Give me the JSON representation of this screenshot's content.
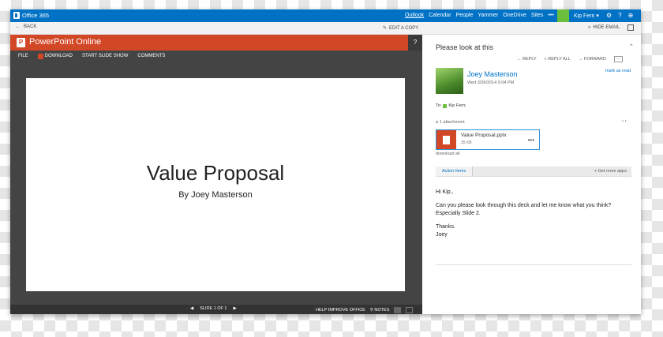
{
  "topbar": {
    "brand": "Office 365",
    "nav": [
      "Outlook",
      "Calendar",
      "People",
      "Yammer",
      "OneDrive",
      "Sites"
    ],
    "more": "•••",
    "user": "Kip Fern ▾",
    "gear": "⚙",
    "help": "?",
    "globe": "⊕"
  },
  "subbar": {
    "back": "BACK",
    "edit_copy": "EDIT A COPY",
    "hide_email": "HIDE EMAIL"
  },
  "ppt": {
    "logo": "P",
    "title": "PowerPoint Online",
    "help": "?",
    "menu": [
      "FILE",
      "DOWNLOAD",
      "START SLIDE SHOW",
      "COMMENTS"
    ],
    "slide_title": "Value Proposal",
    "slide_subtitle": "By Joey Masterson",
    "slide_counter": "SLIDE 1 OF 1",
    "help_improve": "HELP IMPROVE OFFICE",
    "notes": "NOTES"
  },
  "mail": {
    "subject": "Please look at this",
    "reply": "REPLY",
    "reply_all": "REPLY ALL",
    "forward": "FORWARD",
    "sender": "Joey Masterson",
    "date": "Wed 3/26/2014 9:04 PM",
    "mark_read": "mark as read",
    "to_label": "To:",
    "to_name": "Kip Fern;",
    "attachment_count": "1 attachment",
    "attachment_name": "Value Proposal.pptx",
    "attachment_size": "35 KB",
    "download_all": "download all",
    "action_items": "Action Items",
    "get_more_apps": "Get more apps",
    "body": [
      "Hi Kip.,",
      "Can you please look through this deck and let me know what you think? Especially Slide 2.",
      "Thanks.",
      "Joey"
    ]
  }
}
